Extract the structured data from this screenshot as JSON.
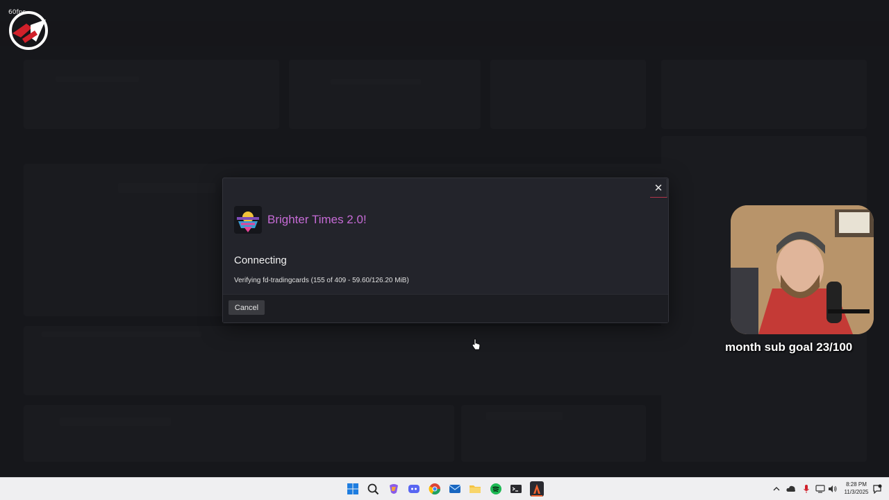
{
  "stream_overlay": {
    "counter": "60fps"
  },
  "dialog": {
    "close_label": "✕",
    "server_name": "Brighter Times 2.0!",
    "status_title": "Connecting",
    "status_detail": "Verifying fd-tradingcards (155 of 409 - 59.60/126.20 MiB)",
    "cancel_label": "Cancel"
  },
  "webcam": {
    "goal_text": "month sub goal 23/100"
  },
  "taskbar": {
    "apps": [
      "start-icon",
      "search-icon",
      "copilot-icon",
      "discord-icon",
      "chrome-icon",
      "mail-icon",
      "files-icon",
      "spotify-icon",
      "terminal-icon",
      "fivem-icon"
    ],
    "time": "8:28 PM",
    "date": "11/3/2025"
  },
  "colors": {
    "accent": "#c66bd6",
    "close_border": "#b5364a"
  }
}
